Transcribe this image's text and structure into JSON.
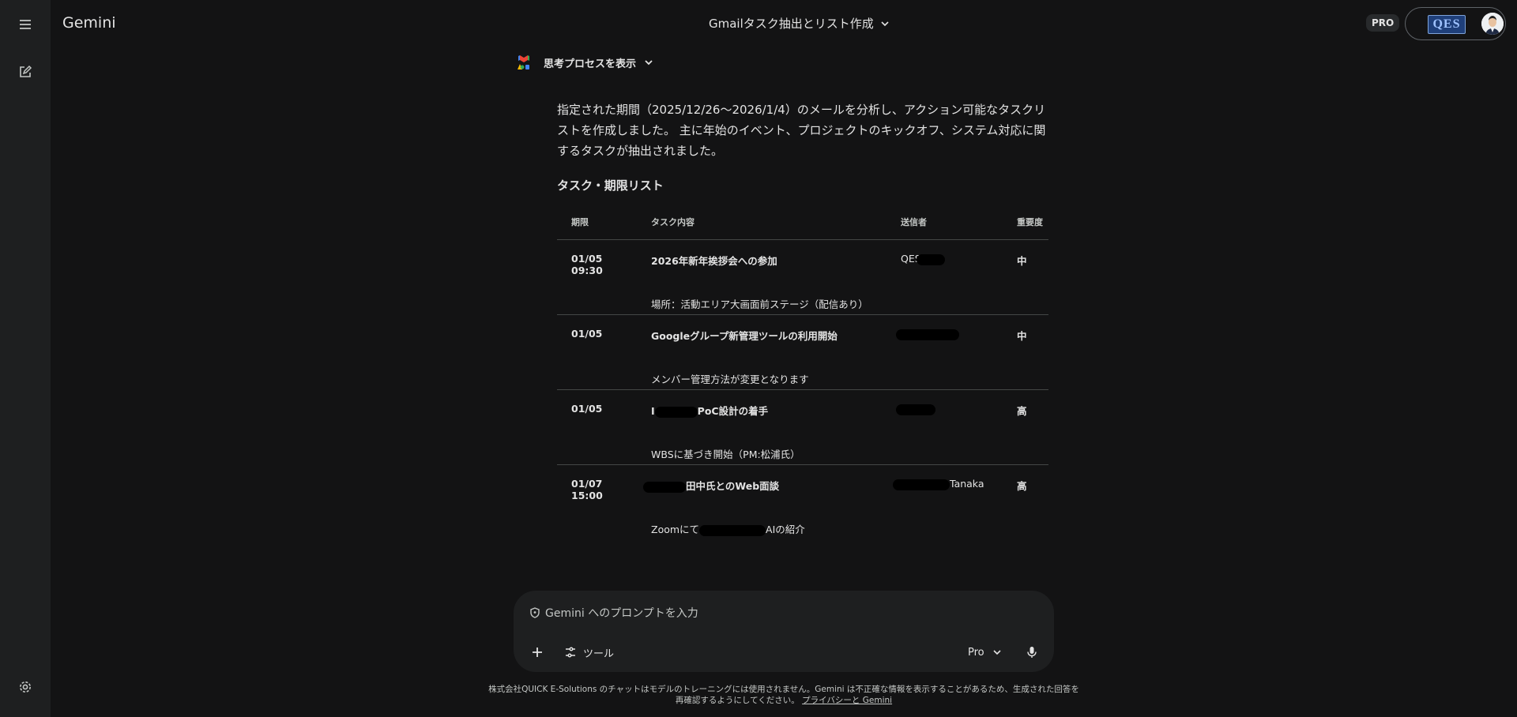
{
  "app": {
    "title": "Gemini"
  },
  "conversation": {
    "title": "Gmailタスク抽出とリスト作成"
  },
  "header": {
    "pro_badge": "PRO",
    "account_logo_text": "QES"
  },
  "response": {
    "thought_toggle": "思考プロセスを表示",
    "intro": "指定された期間（2025/12/26〜2026/1/4）のメールを分析し、アクション可能なタスクリストを作成しました。 主に年始のイベント、プロジェクトのキックオフ、システム対応に関するタスクが抽出されました。",
    "section_title": "タスク・期限リスト",
    "table": {
      "headers": [
        "期限",
        "タスク内容",
        "送信者",
        "重要度"
      ],
      "rows": [
        {
          "due": "01/05 09:30",
          "task_title": "2026年新年挨拶会への参加",
          "task_title_suffix": "",
          "task_detail": "場所：活動エリア大画面前ステージ（配信あり）",
          "task_detail_suffix": "",
          "sender": "QES",
          "sender_suffix": "",
          "priority": "中"
        },
        {
          "due": "01/05",
          "task_title": "Googleグループ新管理ツールの利用開始",
          "task_title_suffix": "",
          "task_detail": "メンバー管理方法が変更となります",
          "task_detail_suffix": "",
          "sender": "",
          "sender_suffix": "",
          "priority": "中"
        },
        {
          "due": "01/05",
          "task_title": "I",
          "task_title_suffix": "PoC設計の着手",
          "task_detail": "WBSに基づき開始（PM:松浦氏）",
          "task_detail_suffix": "",
          "sender": "",
          "sender_suffix": "",
          "priority": "高"
        },
        {
          "due": "01/07 15:00",
          "task_title": "",
          "task_title_suffix": "田中氏とのWeb面談",
          "task_detail": "Zoomにて",
          "task_detail_suffix": "AIの紹介",
          "sender": "",
          "sender_suffix": "Tanaka",
          "priority": "高"
        }
      ]
    }
  },
  "input": {
    "placeholder": "Gemini へのプロンプトを入力",
    "tools_label": "ツール",
    "model_label": "Pro"
  },
  "footer": {
    "disclaimer": "株式会社QUICK E-Solutions のチャットはモデルのトレーニングには使用されません。Gemini は不正確な情報を表示することがあるため、生成された回答を再確認するようにしてください。",
    "privacy_link": "プライバシーと Gemini"
  },
  "colors": {
    "background": "#131314",
    "sidebar": "#1e1f20",
    "input_bg": "#1e1f20",
    "text": "#e3e3e3",
    "divider": "#444746",
    "redaction": "#000000"
  },
  "icons": [
    "menu-icon",
    "new-chat-icon",
    "settings-icon",
    "chevron-down-icon",
    "gemini-gmail-icon",
    "shield-icon",
    "plus-icon",
    "tools-icon",
    "mic-icon"
  ]
}
